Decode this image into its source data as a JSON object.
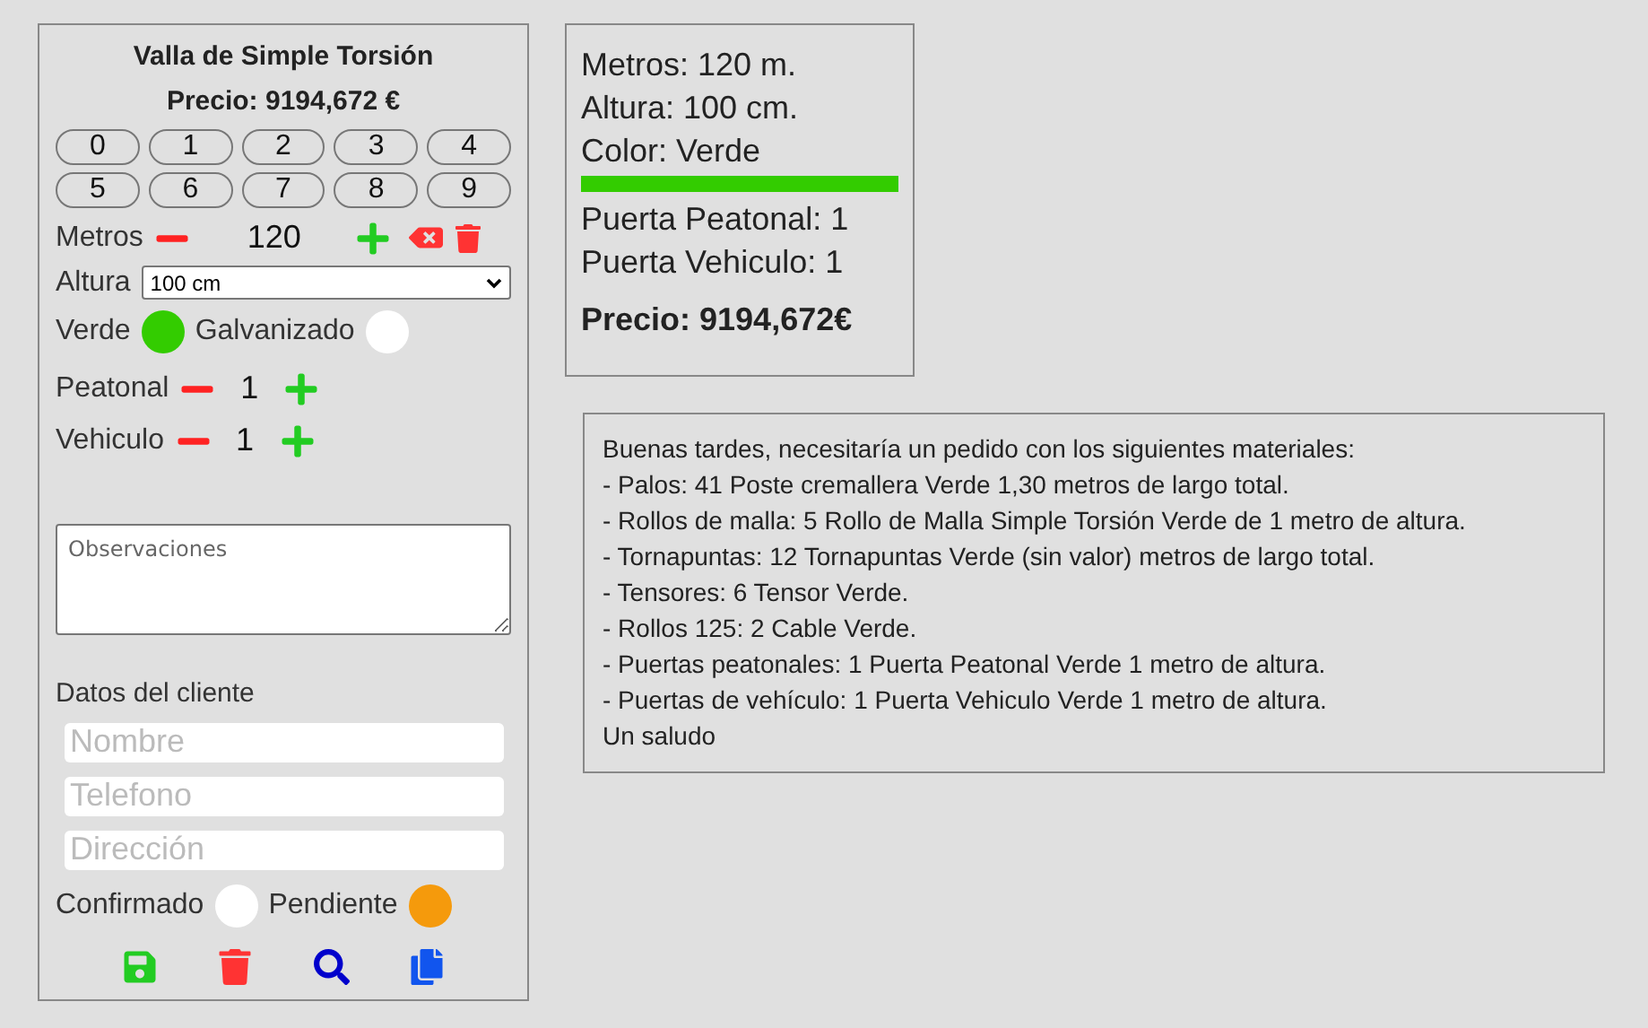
{
  "form": {
    "title": "Valla de Simple Torsión",
    "price": "Precio: 9194,672 €",
    "keypad": [
      "0",
      "1",
      "2",
      "3",
      "4",
      "5",
      "6",
      "7",
      "8",
      "9"
    ],
    "metros": {
      "label": "Metros",
      "value": "120"
    },
    "altura": {
      "label": "Altura",
      "value": "100 cm"
    },
    "color_options": [
      {
        "label": "Verde",
        "selected": true,
        "color": "#33cc00"
      },
      {
        "label": "Galvanizado",
        "selected": false
      }
    ],
    "doors": [
      {
        "label": "Peatonal",
        "value": "1"
      },
      {
        "label": "Vehiculo",
        "value": "1"
      }
    ],
    "notes": {
      "placeholder": "Observaciones"
    },
    "client_heading": "Datos del cliente",
    "client_fields": [
      {
        "placeholder": "Nombre"
      },
      {
        "placeholder": "Telefono"
      },
      {
        "placeholder": "Dirección"
      }
    ],
    "status_options": [
      {
        "label": "Confirmado",
        "selected": false
      },
      {
        "label": "Pendiente",
        "selected": true,
        "color": "#f59a0c"
      }
    ]
  },
  "summary": {
    "lines": [
      "Metros: 120 m.",
      "Altura: 100 cm.",
      "Color: Verde"
    ],
    "color_bar": {
      "color": "#33cc00"
    },
    "door_lines": [
      "Puerta Peatonal: 1",
      "Puerta Vehiculo: 1"
    ],
    "price": "Precio: 9194,672€"
  },
  "message": [
    "Buenas tardes, necesitaría un pedido con los siguientes materiales:",
    "- Palos: 41 Poste cremallera Verde 1,30 metros de largo total.",
    "- Rollos de malla: 5 Rollo de Malla Simple Torsión Verde de 1 metro de altura.",
    "- Tornapuntas: 12 Tornapuntas Verde (sin valor) metros de largo total.",
    "- Tensores: 6 Tensor Verde.",
    "- Rollos 125: 2 Cable Verde.",
    "- Puertas peatonales: 1 Puerta Peatonal Verde 1 metro de altura.",
    "- Puertas de vehículo: 1 Puerta Vehiculo Verde 1 metro de altura.",
    "Un saludo"
  ]
}
